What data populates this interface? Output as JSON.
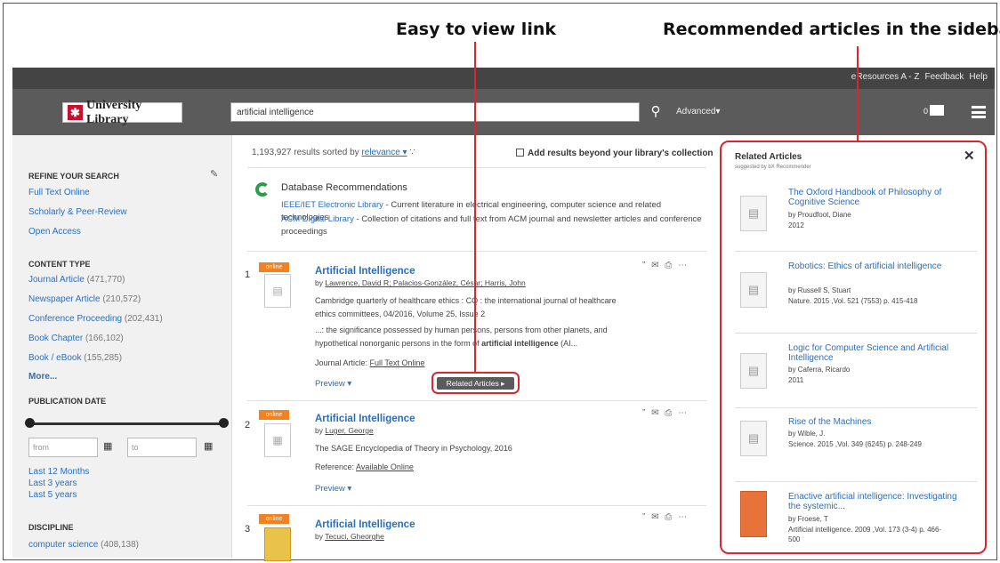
{
  "annotations": {
    "easy_view": "Easy to view link",
    "recommended": "Recommended articles in the sideba"
  },
  "topbar": {
    "links": [
      "eResources A - Z",
      "Feedback",
      "Help"
    ]
  },
  "header": {
    "logo_text": "University Library",
    "search_value": "artificial intelligence",
    "advanced_label": "Advanced▾",
    "folder_count": "0"
  },
  "sidebar": {
    "refine_heading": "REFINE YOUR SEARCH",
    "refine_items": [
      "Full Text Online",
      "Scholarly & Peer-Review",
      "Open Access"
    ],
    "content_type_heading": "CONTENT TYPE",
    "content_types": [
      {
        "label": "Journal Article",
        "count": "(471,770)"
      },
      {
        "label": "Newspaper Article",
        "count": "(210,572)"
      },
      {
        "label": "Conference Proceeding",
        "count": "(202,431)"
      },
      {
        "label": "Book Chapter",
        "count": "(166,102)"
      },
      {
        "label": "Book / eBook",
        "count": "(155,285)"
      }
    ],
    "more_label": "More...",
    "pub_date_heading": "PUBLICATION DATE",
    "from_placeholder": "from",
    "to_placeholder": "to",
    "date_links": [
      "Last 12 Months",
      "Last 3 years",
      "Last 5 years"
    ],
    "discipline_heading": "DISCIPLINE",
    "discipline_item": {
      "label": "computer science",
      "count": "(408,138)"
    }
  },
  "results": {
    "count_text": "1,193,927 results sorted by",
    "sort_label": "relevance ▾",
    "beyond_label": "Add results beyond your library's collection",
    "db_title": "Database Recommendations",
    "db_recs": [
      {
        "link": "IEEE/IET Electronic Library",
        "desc": " - Current literature in electrical engineering, computer science and related technologies"
      },
      {
        "link": "ACM Digital Library",
        "desc": " - Collection of citations and full text from ACM journal and newsletter articles and conference proceedings"
      }
    ],
    "items": [
      {
        "num": "1",
        "badge": "online",
        "title": "Artificial Intelligence",
        "by_prefix": "by ",
        "authors": "Lawrence, David R; Palacios-González, César; Harris, John",
        "source": "Cambridge quarterly of healthcare ethics : CQ : the international journal of healthcare ethics committees, 04/2016, Volume 25, Issue 2",
        "snippet_a": "...: the significance possessed by human persons, persons from other planets, and hypothetical nonorganic persons in the form of ",
        "snippet_b": "artificial intelligence",
        "snippet_c": " (AI...",
        "access_prefix": "Journal Article: ",
        "access_link": "Full Text Online",
        "preview": "Preview ▾",
        "related_btn": "Related Articles ▸"
      },
      {
        "num": "2",
        "badge": "online",
        "title": "Artificial Intelligence",
        "by_prefix": "by ",
        "authors": "Luger, George",
        "source": "The SAGE Encyclopedia of Theory in Psychology, 2016",
        "access_prefix": "Reference: ",
        "access_link": "Available Online",
        "preview": "Preview ▾"
      },
      {
        "num": "3",
        "badge": "online",
        "title": "Artificial Intelligence",
        "by_prefix": "by ",
        "authors": "Tecuci, Gheorghe"
      }
    ]
  },
  "related": {
    "title": "Related Articles",
    "subtitle": "suggested by bX Recommender",
    "close": "✕",
    "articles": [
      {
        "title": "The Oxford Handbook of Philosophy of Cognitive Science",
        "author": "by Proudfoot, Diane",
        "detail": "2012"
      },
      {
        "title": "Robotics: Ethics of artificial intelligence",
        "author": "by Russell S, Stuart",
        "detail": "Nature. 2015 ,Vol. 521 (7553) p. 415-418"
      },
      {
        "title": "Logic for Computer Science and Artificial Intelligence",
        "author": "by Caferra, Ricardo",
        "detail": "2011"
      },
      {
        "title": "Rise of the Machines",
        "author": "by Wible, J.",
        "detail": "Science. 2015 ,Vol. 349 (6245) p. 248-249"
      },
      {
        "title": "Enactive artificial intelligence: Investigating the systemic...",
        "author": "by Froese, T",
        "detail": "Artificial intelligence. 2009 ,Vol. 173 (3-4) p. 466-500"
      }
    ]
  },
  "icons": [
    "search-icon",
    "rss-icon",
    "pencil-icon",
    "folder-icon",
    "menu-icon",
    "cite-icon",
    "email-icon",
    "print-icon",
    "more-icon",
    "calendar-icon",
    "close-icon",
    "document-icon"
  ],
  "colors": {
    "accent_red": "#d7272f",
    "link_blue": "#2a6ebb",
    "badge_orange": "#f2821f",
    "header_gray": "#5b5b5b",
    "topbar_gray": "#444444"
  }
}
